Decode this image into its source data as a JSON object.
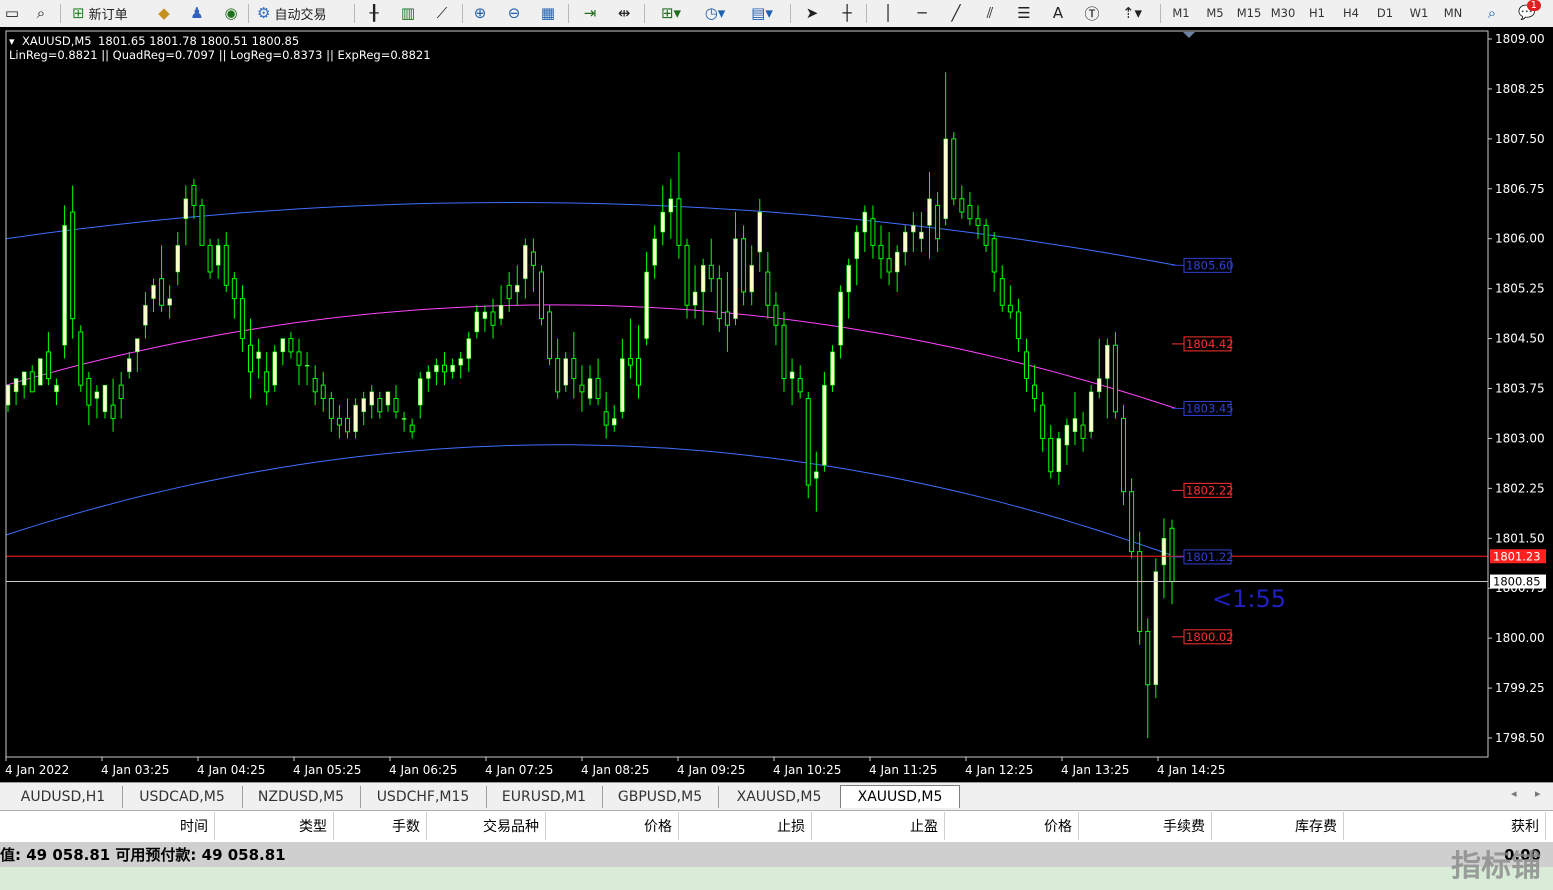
{
  "toolbar": {
    "new_order_label": "新订单",
    "auto_trade_label": "自动交易",
    "timeframes": [
      "M1",
      "M5",
      "M15",
      "M30",
      "H1",
      "H4",
      "D1",
      "W1",
      "MN"
    ],
    "notification_count": "1",
    "text_tool_label": "A",
    "icons": [
      "new-chart-icon",
      "profiles-icon",
      "new-order-icon",
      "market-watch-icon",
      "navigator-icon",
      "signals-icon",
      "auto-trading-icon",
      "bar-chart-icon",
      "candlestick-icon",
      "line-chart-icon",
      "zoom-in-icon",
      "zoom-out-icon",
      "tile-windows-icon",
      "auto-scroll-icon",
      "chart-shift-icon",
      "indicators-icon",
      "periods-icon",
      "templates-icon",
      "cursor-icon",
      "crosshair-icon",
      "vertical-line-icon",
      "horizontal-line-icon",
      "trendline-icon",
      "equidistant-channel-icon",
      "fibonacci-icon",
      "text-icon",
      "text-label-icon",
      "arrows-icon",
      "search-icon",
      "notification-icon"
    ]
  },
  "chart": {
    "header_symbol": "XAUUSD,M5",
    "header_ohlc": "1801.65 1801.78 1800.51 1800.85",
    "indicator_text": "LinReg=0.8821 || QuadReg=0.7097 || LogReg=0.8373 || ExpReg=0.8821",
    "countdown": "<1:55",
    "bid_price_label": "1800.85",
    "ask_price_label": "1801.23",
    "price_axis_labels": [
      "1809.00",
      "1808.25",
      "1807.50",
      "1806.75",
      "1806.00",
      "1805.25",
      "1804.50",
      "1803.75",
      "1803.00",
      "1802.25",
      "1801.50",
      "1800.75",
      "1800.00",
      "1799.25",
      "1798.50"
    ],
    "time_axis_labels": [
      "4 Jan 2022",
      "4 Jan 03:25",
      "4 Jan 04:25",
      "4 Jan 05:25",
      "4 Jan 06:25",
      "4 Jan 07:25",
      "4 Jan 08:25",
      "4 Jan 09:25",
      "4 Jan 10:25",
      "4 Jan 11:25",
      "4 Jan 12:25",
      "4 Jan 13:25",
      "4 Jan 14:25"
    ],
    "channel_labels": [
      {
        "text": "1805.60",
        "color": "#3040d0",
        "kind": "blue"
      },
      {
        "text": "1804.42",
        "color": "#ff3030",
        "kind": "red"
      },
      {
        "text": "1803.45",
        "color": "#3040d0",
        "kind": "blue"
      },
      {
        "text": "1802.22",
        "color": "#ff3030",
        "kind": "red"
      },
      {
        "text": "1801.22",
        "color": "#3040d0",
        "kind": "blue"
      },
      {
        "text": "1800.02",
        "color": "#ff3030",
        "kind": "red"
      }
    ],
    "colors": {
      "background": "#000000",
      "bull_candle": "#ffffcc",
      "wick": "#00ff00",
      "upper_channel": "#3f6fff",
      "mid_channel": "#ff44ff",
      "lower_channel": "#3f6fff",
      "ask_line": "#ff2020",
      "bid_line": "#c8c8c8",
      "countdown": "#2020c0"
    }
  },
  "chart_data": {
    "type": "candlestick",
    "symbol": "XAUUSD",
    "timeframe": "M5",
    "ylim": [
      1798.25,
      1809.15
    ],
    "grid": false,
    "x_start": "4 Jan 2022 02:25",
    "x_end": "4 Jan 2022 14:50",
    "candles": [
      [
        1803.5,
        1803.8,
        1803.4,
        1803.8
      ],
      [
        1803.7,
        1803.9,
        1803.5,
        1803.9
      ],
      [
        1803.8,
        1804.0,
        1803.6,
        1804.0
      ],
      [
        1804.0,
        1804.1,
        1803.7,
        1803.7
      ],
      [
        1803.8,
        1804.2,
        1803.8,
        1804.2
      ],
      [
        1804.3,
        1804.6,
        1803.8,
        1803.9
      ],
      [
        1803.7,
        1803.9,
        1803.5,
        1803.8
      ],
      [
        1804.4,
        1806.5,
        1804.2,
        1806.2
      ],
      [
        1806.4,
        1806.8,
        1804.5,
        1804.8
      ],
      [
        1804.6,
        1804.7,
        1803.7,
        1803.8
      ],
      [
        1803.9,
        1804.0,
        1803.2,
        1803.5
      ],
      [
        1803.6,
        1803.8,
        1803.3,
        1803.7
      ],
      [
        1803.4,
        1803.8,
        1803.3,
        1803.8
      ],
      [
        1803.5,
        1803.9,
        1803.1,
        1803.3
      ],
      [
        1803.8,
        1804.0,
        1803.3,
        1803.6
      ],
      [
        1804.0,
        1804.3,
        1803.9,
        1804.2
      ],
      [
        1804.3,
        1804.5,
        1804.0,
        1804.5
      ],
      [
        1804.7,
        1805.2,
        1804.5,
        1805.0
      ],
      [
        1805.1,
        1805.4,
        1804.9,
        1805.3
      ],
      [
        1805.4,
        1805.9,
        1804.9,
        1805.0
      ],
      [
        1805.0,
        1805.3,
        1804.8,
        1805.1
      ],
      [
        1805.5,
        1806.1,
        1805.3,
        1805.9
      ],
      [
        1806.3,
        1806.8,
        1805.9,
        1806.6
      ],
      [
        1806.8,
        1806.9,
        1806.3,
        1806.5
      ],
      [
        1806.5,
        1806.6,
        1805.9,
        1805.9
      ],
      [
        1805.9,
        1806.0,
        1805.4,
        1805.5
      ],
      [
        1805.6,
        1806.0,
        1805.4,
        1805.9
      ],
      [
        1805.9,
        1806.1,
        1805.2,
        1805.3
      ],
      [
        1805.4,
        1805.5,
        1804.8,
        1805.1
      ],
      [
        1805.1,
        1805.3,
        1804.3,
        1804.5
      ],
      [
        1804.4,
        1804.8,
        1803.6,
        1804.0
      ],
      [
        1804.2,
        1804.5,
        1803.9,
        1804.3
      ],
      [
        1804.0,
        1804.3,
        1803.5,
        1803.7
      ],
      [
        1803.8,
        1804.4,
        1803.7,
        1804.3
      ],
      [
        1804.3,
        1804.5,
        1804.1,
        1804.5
      ],
      [
        1804.5,
        1804.6,
        1804.2,
        1804.3
      ],
      [
        1804.3,
        1804.5,
        1803.8,
        1804.1
      ],
      [
        1804.1,
        1804.3,
        1803.8,
        1804.1
      ],
      [
        1803.9,
        1804.1,
        1803.5,
        1803.7
      ],
      [
        1803.8,
        1804.0,
        1803.4,
        1803.6
      ],
      [
        1803.6,
        1803.7,
        1803.1,
        1803.3
      ],
      [
        1803.3,
        1803.5,
        1803.0,
        1803.2
      ],
      [
        1803.3,
        1803.6,
        1803.0,
        1803.1
      ],
      [
        1803.1,
        1803.6,
        1803.0,
        1803.5
      ],
      [
        1803.4,
        1803.7,
        1803.2,
        1803.6
      ],
      [
        1803.5,
        1803.8,
        1803.3,
        1803.7
      ],
      [
        1803.6,
        1803.7,
        1803.3,
        1803.4
      ],
      [
        1803.5,
        1803.7,
        1803.4,
        1803.7
      ],
      [
        1803.6,
        1803.8,
        1803.3,
        1803.4
      ],
      [
        1803.3,
        1803.4,
        1803.1,
        1803.3
      ],
      [
        1803.2,
        1803.3,
        1803.0,
        1803.1
      ],
      [
        1803.5,
        1804.0,
        1803.3,
        1803.9
      ],
      [
        1803.9,
        1804.1,
        1803.7,
        1804.0
      ],
      [
        1804.0,
        1804.2,
        1803.8,
        1804.1
      ],
      [
        1804.1,
        1804.3,
        1803.8,
        1804.0
      ],
      [
        1804.0,
        1804.2,
        1803.9,
        1804.1
      ],
      [
        1804.1,
        1804.3,
        1803.9,
        1804.2
      ],
      [
        1804.2,
        1804.6,
        1804.0,
        1804.5
      ],
      [
        1804.6,
        1805.0,
        1804.5,
        1804.9
      ],
      [
        1804.8,
        1805.0,
        1804.6,
        1804.9
      ],
      [
        1804.9,
        1805.1,
        1804.5,
        1804.7
      ],
      [
        1804.8,
        1805.3,
        1804.7,
        1805.0
      ],
      [
        1805.3,
        1805.5,
        1804.9,
        1805.1
      ],
      [
        1805.2,
        1805.6,
        1805.0,
        1805.3
      ],
      [
        1805.4,
        1806.0,
        1805.1,
        1805.9
      ],
      [
        1805.8,
        1806.0,
        1805.2,
        1805.6
      ],
      [
        1805.5,
        1805.6,
        1804.7,
        1804.8
      ],
      [
        1804.9,
        1805.0,
        1804.1,
        1804.2
      ],
      [
        1804.2,
        1804.5,
        1803.6,
        1803.7
      ],
      [
        1803.8,
        1804.3,
        1803.7,
        1804.2
      ],
      [
        1804.2,
        1804.6,
        1803.6,
        1803.9
      ],
      [
        1803.8,
        1804.1,
        1803.4,
        1803.7
      ],
      [
        1803.6,
        1804.1,
        1803.5,
        1803.9
      ],
      [
        1803.9,
        1804.2,
        1803.5,
        1803.6
      ],
      [
        1803.4,
        1803.7,
        1803.0,
        1803.2
      ],
      [
        1803.2,
        1803.5,
        1803.1,
        1803.3
      ],
      [
        1803.4,
        1804.5,
        1803.3,
        1804.2
      ],
      [
        1804.2,
        1804.8,
        1803.9,
        1804.1
      ],
      [
        1804.2,
        1804.7,
        1803.6,
        1803.8
      ],
      [
        1804.5,
        1805.8,
        1804.4,
        1805.5
      ],
      [
        1805.6,
        1806.2,
        1805.4,
        1806.0
      ],
      [
        1806.1,
        1806.8,
        1805.9,
        1806.4
      ],
      [
        1806.4,
        1806.9,
        1806.0,
        1806.6
      ],
      [
        1806.6,
        1807.3,
        1805.7,
        1805.9
      ],
      [
        1805.9,
        1806.0,
        1804.8,
        1805.0
      ],
      [
        1805.0,
        1805.6,
        1804.8,
        1805.2
      ],
      [
        1805.2,
        1805.7,
        1804.7,
        1805.6
      ],
      [
        1805.6,
        1806.0,
        1805.2,
        1805.4
      ],
      [
        1805.4,
        1805.6,
        1804.6,
        1804.8
      ],
      [
        1804.9,
        1805.5,
        1804.3,
        1804.7
      ],
      [
        1804.8,
        1806.4,
        1804.7,
        1806.0
      ],
      [
        1806.0,
        1806.2,
        1805.0,
        1805.2
      ],
      [
        1805.2,
        1805.9,
        1805.0,
        1805.6
      ],
      [
        1805.8,
        1806.6,
        1805.5,
        1806.4
      ],
      [
        1805.5,
        1805.8,
        1804.8,
        1805.0
      ],
      [
        1805.0,
        1805.2,
        1804.4,
        1804.7
      ],
      [
        1804.7,
        1804.9,
        1803.7,
        1803.9
      ],
      [
        1803.9,
        1804.2,
        1803.5,
        1804.0
      ],
      [
        1803.9,
        1804.1,
        1803.6,
        1803.7
      ],
      [
        1803.6,
        1803.7,
        1802.1,
        1802.3
      ],
      [
        1802.4,
        1802.8,
        1801.9,
        1802.5
      ],
      [
        1802.6,
        1804.0,
        1802.5,
        1803.8
      ],
      [
        1803.8,
        1804.4,
        1803.7,
        1804.3
      ],
      [
        1804.4,
        1805.3,
        1804.2,
        1805.2
      ],
      [
        1805.2,
        1805.7,
        1804.8,
        1805.6
      ],
      [
        1805.7,
        1806.2,
        1805.3,
        1806.1
      ],
      [
        1806.1,
        1806.5,
        1805.8,
        1806.4
      ],
      [
        1806.3,
        1806.5,
        1805.7,
        1805.9
      ],
      [
        1805.9,
        1806.2,
        1805.4,
        1805.7
      ],
      [
        1805.7,
        1806.1,
        1805.3,
        1805.5
      ],
      [
        1805.5,
        1805.9,
        1805.2,
        1805.8
      ],
      [
        1805.8,
        1806.2,
        1805.6,
        1806.1
      ],
      [
        1806.1,
        1806.4,
        1805.8,
        1806.2
      ],
      [
        1806.0,
        1806.4,
        1805.8,
        1806.1
      ],
      [
        1806.2,
        1807.0,
        1805.7,
        1806.6
      ],
      [
        1806.5,
        1806.7,
        1805.8,
        1806.0
      ],
      [
        1806.3,
        1808.5,
        1806.2,
        1807.5
      ],
      [
        1807.5,
        1807.6,
        1806.5,
        1806.6
      ],
      [
        1806.6,
        1806.8,
        1806.3,
        1806.4
      ],
      [
        1806.5,
        1806.7,
        1806.2,
        1806.3
      ],
      [
        1806.3,
        1806.5,
        1806.0,
        1806.2
      ],
      [
        1806.2,
        1806.3,
        1805.8,
        1805.9
      ],
      [
        1806.0,
        1806.1,
        1805.2,
        1805.5
      ],
      [
        1805.4,
        1805.6,
        1804.9,
        1805.0
      ],
      [
        1805.0,
        1805.3,
        1804.8,
        1804.9
      ],
      [
        1804.9,
        1805.1,
        1804.3,
        1804.5
      ],
      [
        1804.3,
        1804.5,
        1803.7,
        1803.9
      ],
      [
        1803.8,
        1804.1,
        1803.4,
        1803.6
      ],
      [
        1803.5,
        1803.7,
        1802.8,
        1803.0
      ],
      [
        1803.0,
        1803.2,
        1802.4,
        1802.5
      ],
      [
        1802.5,
        1803.1,
        1802.3,
        1803.0
      ],
      [
        1802.9,
        1803.3,
        1802.6,
        1803.2
      ],
      [
        1803.1,
        1803.7,
        1802.9,
        1803.3
      ],
      [
        1803.2,
        1803.4,
        1802.8,
        1803.0
      ],
      [
        1803.1,
        1803.8,
        1803.0,
        1803.7
      ],
      [
        1803.7,
        1804.5,
        1803.6,
        1803.9
      ],
      [
        1803.9,
        1804.5,
        1803.3,
        1804.4
      ],
      [
        1804.4,
        1804.6,
        1803.3,
        1803.4
      ],
      [
        1803.3,
        1803.5,
        1802.0,
        1802.2
      ],
      [
        1802.2,
        1802.4,
        1801.2,
        1801.3
      ],
      [
        1801.3,
        1801.6,
        1799.9,
        1800.1
      ],
      [
        1800.1,
        1800.3,
        1798.5,
        1799.3
      ],
      [
        1799.3,
        1801.2,
        1799.1,
        1801.0
      ],
      [
        1801.1,
        1801.8,
        1800.6,
        1801.5
      ],
      [
        1801.65,
        1801.78,
        1800.51,
        1800.85
      ]
    ]
  },
  "tabs": {
    "items": [
      "AUDUSD,H1",
      "USDCAD,M5",
      "NZDUSD,M5",
      "USDCHF,M15",
      "EURUSD,M1",
      "GBPUSD,M5",
      "XAUUSD,M5",
      "XAUUSD,M5"
    ],
    "active_index": 7
  },
  "terminal": {
    "columns": [
      "时间",
      "类型",
      "手数",
      "交易品种",
      "价格",
      "止损",
      "止盈",
      "价格",
      "手续费",
      "库存费",
      "获利"
    ],
    "balance_text": "值: 49 058.81  可用预付款: 49 058.81",
    "profit_value": "0.00"
  },
  "watermark": "指标铺"
}
